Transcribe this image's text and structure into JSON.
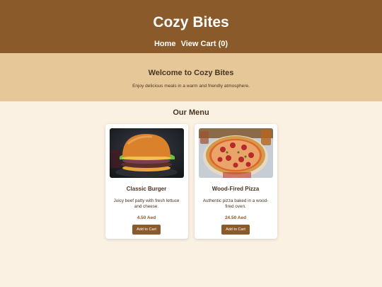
{
  "header": {
    "title": "Cozy Bites",
    "nav": [
      {
        "label": "Home"
      },
      {
        "label": "View Cart (0)"
      }
    ]
  },
  "hero": {
    "heading": "Welcome to Cozy Bites",
    "subtitle": "Enjoy delicious meals in a warm and friendly atmosphere."
  },
  "menu": {
    "title": "Our Menu",
    "items": [
      {
        "name": "Classic Burger",
        "description": "Juicy beef patty with fresh lettuce and cheese.",
        "price": "4.50 Aed",
        "button_label": "Add to Cart",
        "image": "burger"
      },
      {
        "name": "Wood-Fired Pizza",
        "description": "Authentic pizza baked in a wood-fired oven.",
        "price": "24.50 Aed",
        "button_label": "Add to Cart",
        "image": "pizza"
      }
    ]
  },
  "colors": {
    "header_bg": "#8b5a2b",
    "hero_bg": "#e6c898",
    "page_bg": "#fbf1e3",
    "button_bg": "#8b5a2b"
  }
}
